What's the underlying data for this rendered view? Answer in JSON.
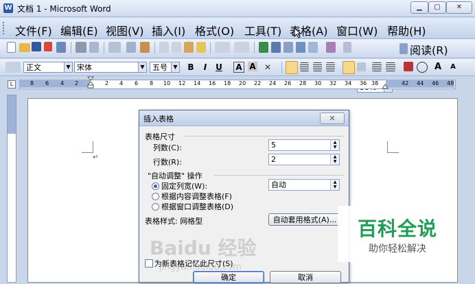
{
  "window": {
    "title": "文档 1 - Microsoft Word",
    "app_icon": "W",
    "btn_min": "▁",
    "btn_max": "▢",
    "btn_close": "✕"
  },
  "menu": {
    "items": [
      "文件(F)",
      "编辑(E)",
      "视图(V)",
      "插入(I)",
      "格式(O)",
      "工具(T)",
      "表格(A)",
      "窗口(W)",
      "帮助(H)"
    ]
  },
  "standard_toolbar": {
    "zoom": "90%",
    "read_label": "阅读(R)"
  },
  "format_toolbar": {
    "style": "正文",
    "font": "宋体",
    "size": "五号",
    "bold": "B",
    "italic": "I",
    "underline": "U",
    "fontcolor": "A",
    "charshade": "A",
    "grow": "A",
    "shrink": "A"
  },
  "ruler": {
    "numbers": [
      "8",
      "6",
      "4",
      "2",
      "2",
      "4",
      "6",
      "8",
      "10",
      "12",
      "14",
      "16",
      "18",
      "20",
      "22",
      "24",
      "26",
      "28",
      "30",
      "32",
      "34",
      "36",
      "38",
      "42",
      "44",
      "46",
      "48"
    ]
  },
  "page": {
    "para_mark": "↵"
  },
  "dialog": {
    "title": "插入表格",
    "close_label": "✕",
    "size_group": "表格尺寸",
    "cols_label": "列数(C):",
    "cols_value": "5",
    "rows_label": "行数(R):",
    "rows_value": "2",
    "autofit_group": "\"自动调整\" 操作",
    "fixed_label": "固定列宽(W):",
    "fixed_value": "自动",
    "content_label": "根据内容调整表格(F)",
    "window_label": "根据窗口调整表格(D)",
    "style_label": "表格样式:  网格型",
    "autoformat_button": "自动套用格式(A)...",
    "remember_label": "为新表格记忆此尺寸(S)",
    "ok_button": "确定",
    "cancel_button": "取消"
  },
  "watermark": {
    "baike_title": "百科全说",
    "baike_sub": "助你轻松解决",
    "baidu": "Baidu 经验",
    "url": "jingyan.baidu.com"
  },
  "colors": {
    "accent": "#2b58b3",
    "baike_green": "#1f9d55"
  }
}
